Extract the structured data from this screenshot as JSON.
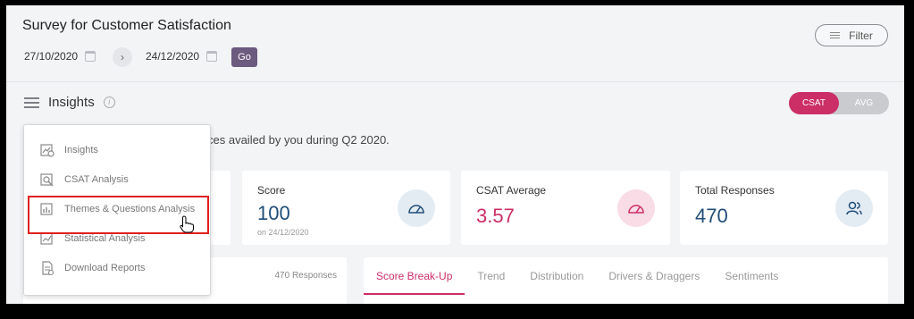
{
  "header": {
    "title": "Survey for Customer Satisfaction",
    "start_date": "27/10/2020",
    "end_date": "24/12/2020",
    "go_label": "Go",
    "filter_label": "Filter"
  },
  "insights": {
    "title": "Insights",
    "toggle_csat": "CSAT",
    "toggle_avg": "AVG",
    "subtitle": "ces availed by you during Q2 2020."
  },
  "cards": [
    {
      "label": "Score",
      "value": "100",
      "sub": "on 24/12/2020",
      "value_color": "#1f4d78",
      "icon": "speedometer-icon"
    },
    {
      "label": "CSAT Average",
      "value": "3.57",
      "value_color": "#cc2e66",
      "icon": "speedometer-icon"
    },
    {
      "label": "Total Responses",
      "value": "470",
      "value_color": "#1f4d78",
      "icon": "users-icon"
    }
  ],
  "responses_label": "470 Responses",
  "tabs": [
    {
      "label": "Score Break-Up",
      "active": true
    },
    {
      "label": "Trend",
      "active": false
    },
    {
      "label": "Distribution",
      "active": false
    },
    {
      "label": "Drivers & Draggers",
      "active": false
    },
    {
      "label": "Sentiments",
      "active": false
    }
  ],
  "menu": {
    "items": [
      {
        "label": "Insights",
        "icon": "insights-icon"
      },
      {
        "label": "CSAT Analysis",
        "icon": "csat-analysis-icon"
      },
      {
        "label": "Themes & Questions Analysis",
        "icon": "themes-analysis-icon"
      },
      {
        "label": "Statistical Analysis",
        "icon": "statistical-analysis-icon"
      },
      {
        "label": "Download Reports",
        "icon": "download-reports-icon"
      }
    ]
  },
  "colors": {
    "accent": "#cc2e66",
    "go_button": "#6d5a7f",
    "highlight_border": "#e02020"
  }
}
